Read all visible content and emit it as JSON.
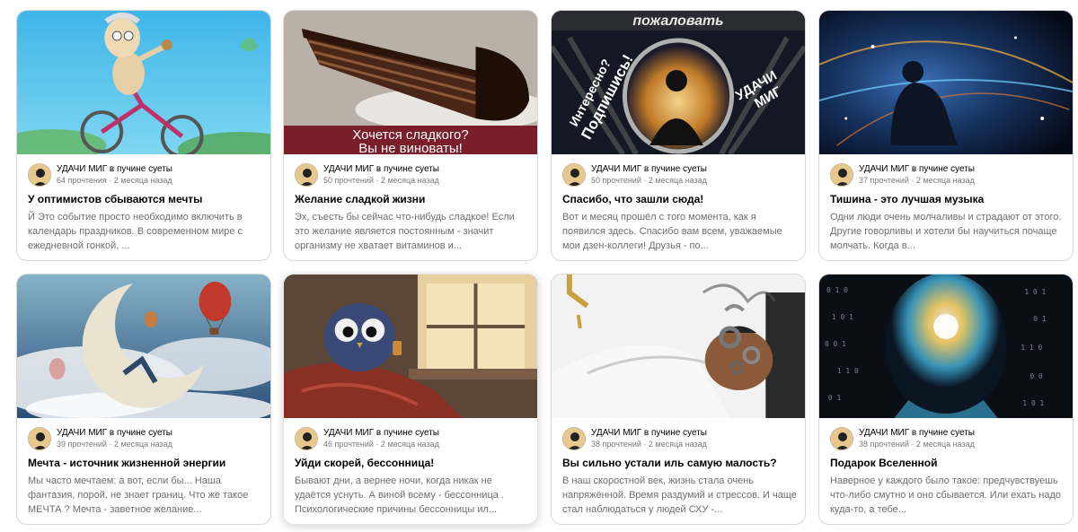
{
  "feed": {
    "cards": [
      {
        "channel": "УДАЧИ МИГ в пучине суеты",
        "stats": "64 прочтения · 2 месяца назад",
        "title": "У оптимистов сбываются мечты",
        "snippet": "Й Это событие просто необходимо включить в календарь праздников. В современном мире с ежедневной гонкой, ...",
        "image": "cartoon-granny-on-bicycle"
      },
      {
        "channel": "УДАЧИ МИГ в пучине суеты",
        "stats": "50 прочтений · 2 месяца назад",
        "title": "Желание сладкой жизни",
        "snippet": "Эх, съесть бы сейчас что-нибудь сладкое! Если это желание является постоянным - значит организму не хватает витаминов и...",
        "image": "chocolate-cake-slice",
        "overlay_line1": "Хочется сладкого?",
        "overlay_line2": "Вы не виноваты!"
      },
      {
        "channel": "УДАЧИ МИГ в пучине суеты",
        "stats": "50 прочтений · 2 месяца назад",
        "title": "Спасибо, что зашли сюда!",
        "snippet": "Вот и месяц прошёл с того момента, как я появился здесь. Спасибо вам всем, уважаемые мои дзен-коллеги! Друзья - по...",
        "image": "silhouette-portal-welcome",
        "overlay_top": "пожаловать",
        "overlay_left1": "Интересно?",
        "overlay_left2": "Подпишись!",
        "overlay_right1": "УДАЧИ",
        "overlay_right2": "МИГ"
      },
      {
        "channel": "УДАЧИ МИГ в пучине суеты",
        "stats": "37 прочтений · 2 месяца назад",
        "title": "Тишина - это лучшая музыка",
        "snippet": "Одни люди очень молчаливы и страдают от этого. Другие говорливы и хотели бы научиться почаще молчать. Когда в...",
        "image": "man-sitting-in-cosmos"
      },
      {
        "channel": "УДАЧИ МИГ в пучине суеты",
        "stats": "39 прочтений · 2 месяца назад",
        "title": "Мечта - источник жизненной энергии",
        "snippet": "Мы часто мечтаем: а вот, если бы... Наша фантазия, порой, не знает границ. Что же такое МЕЧТА ? Мечта - заветное желание...",
        "image": "crescent-moon-balloons"
      },
      {
        "channel": "УДАЧИ МИГ в пучине суеты",
        "stats": "46 прочтений · 2 месяца назад",
        "title": "Уйди скорей, бессонница!",
        "snippet": "Бывают дни, а вернее ночи, когда никак не удаётся уснуть. А виной всему - бессонница . Психологические причины бессонницы ил...",
        "image": "sleepless-owl-by-window"
      },
      {
        "channel": "УДАЧИ МИГ в пучине суеты",
        "stats": "38 прочтений · 2 месяца назад",
        "title": "Вы сильно устали иль самую малость?",
        "snippet": "В наш скоростной век, жизнь стала очень напряжённой. Время раздумий и стрессов. И чаще стал наблюдаться у людей СХУ -...",
        "image": "tired-man-gears-head"
      },
      {
        "channel": "УДАЧИ МИГ в пучине суеты",
        "stats": "38 прочтений · 2 месяца назад",
        "title": "Подарок Вселенной",
        "snippet": "Наверное у каждого было такое: предчувствуешь что-либо смутно и оно сбывается. Или ехать надо куда-то, а тебе...",
        "image": "glowing-head-binary-code"
      }
    ]
  }
}
